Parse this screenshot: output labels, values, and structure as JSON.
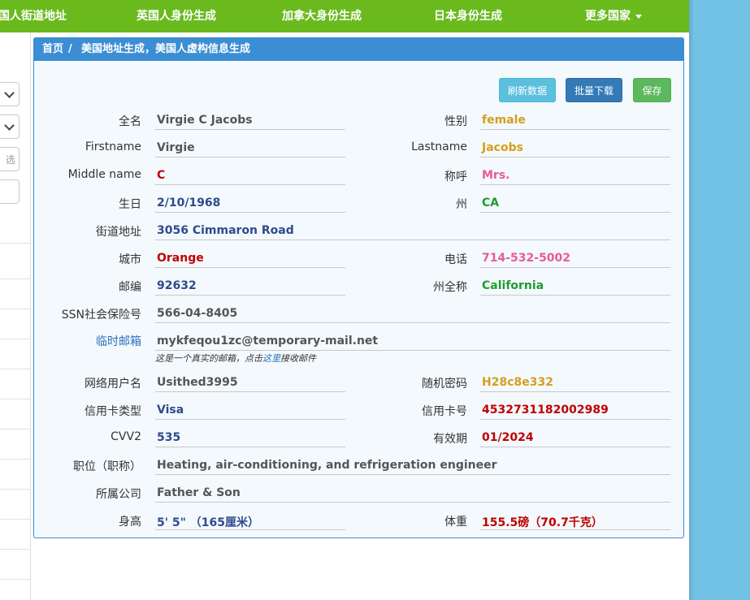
{
  "nav": {
    "items": [
      "美国人街道地址",
      "英国人身份生成",
      "加拿大身份生成",
      "日本身份生成",
      "更多国家"
    ]
  },
  "left": {
    "input_hint": "选"
  },
  "panel": {
    "breadcrumb_home": "首页",
    "breadcrumb_sep": "/",
    "breadcrumb_current": "美国地址生成，美国人虚构信息生成",
    "buttons": {
      "refresh": "刷新数据",
      "download": "批量下载",
      "save": "保存"
    }
  },
  "fields": {
    "fullname": {
      "label": "全名",
      "value": "Virgie C Jacobs"
    },
    "gender": {
      "label": "性别",
      "value": "female"
    },
    "firstname": {
      "label": "Firstname",
      "value": "Virgie"
    },
    "lastname": {
      "label": "Lastname",
      "value": "Jacobs"
    },
    "middlename": {
      "label": "Middle name",
      "value": "C"
    },
    "title": {
      "label": "称呼",
      "value": "Mrs."
    },
    "birthday": {
      "label": "生日",
      "value": "2/10/1968"
    },
    "state": {
      "label": "州",
      "value": "CA"
    },
    "street": {
      "label": "街道地址",
      "value": "3056 Cimmaron Road"
    },
    "city": {
      "label": "城市",
      "value": "Orange"
    },
    "phone": {
      "label": "电话",
      "value": "714-532-5002"
    },
    "zip": {
      "label": "邮编",
      "value": "92632"
    },
    "state_full": {
      "label": "州全称",
      "value": "California"
    },
    "ssn": {
      "label": "SSN社会保险号",
      "value": "566-04-8405"
    },
    "email": {
      "label": "临时邮箱",
      "value": "mykfeqou1zc@temporary-mail.net",
      "note_before": "这是一个真实的邮箱，点击",
      "note_link": "这里",
      "note_after": "接收邮件"
    },
    "username": {
      "label": "网络用户名",
      "value": "Usithed3995"
    },
    "password": {
      "label": "随机密码",
      "value": "H28c8e332"
    },
    "card_type": {
      "label": "信用卡类型",
      "value": "Visa"
    },
    "card_no": {
      "label": "信用卡号",
      "value": "4532731182002989"
    },
    "cvv": {
      "label": "CVV2",
      "value": "535"
    },
    "expiry": {
      "label": "有效期",
      "value": "01/2024"
    },
    "job": {
      "label": "职位（职称）",
      "value": "Heating, air-conditioning, and refrigeration engineer"
    },
    "company": {
      "label": "所属公司",
      "value": "Father & Son"
    },
    "height": {
      "label": "身高",
      "value": "5' 5\"  （165厘米）"
    },
    "weight": {
      "label": "体重",
      "value": "155.5磅（70.7千克）"
    }
  },
  "colors": {
    "nav_bg": "#6aba1e",
    "panel_border": "#3b8ed3",
    "btn_refresh": "#5bc0de",
    "btn_download": "#337ab7",
    "btn_save": "#5cb85c",
    "value_red": "#c00000",
    "value_gold": "#d4a01c",
    "value_pink": "#e95c93",
    "value_green": "#1f9d30",
    "value_navy": "#2e4b8c"
  }
}
